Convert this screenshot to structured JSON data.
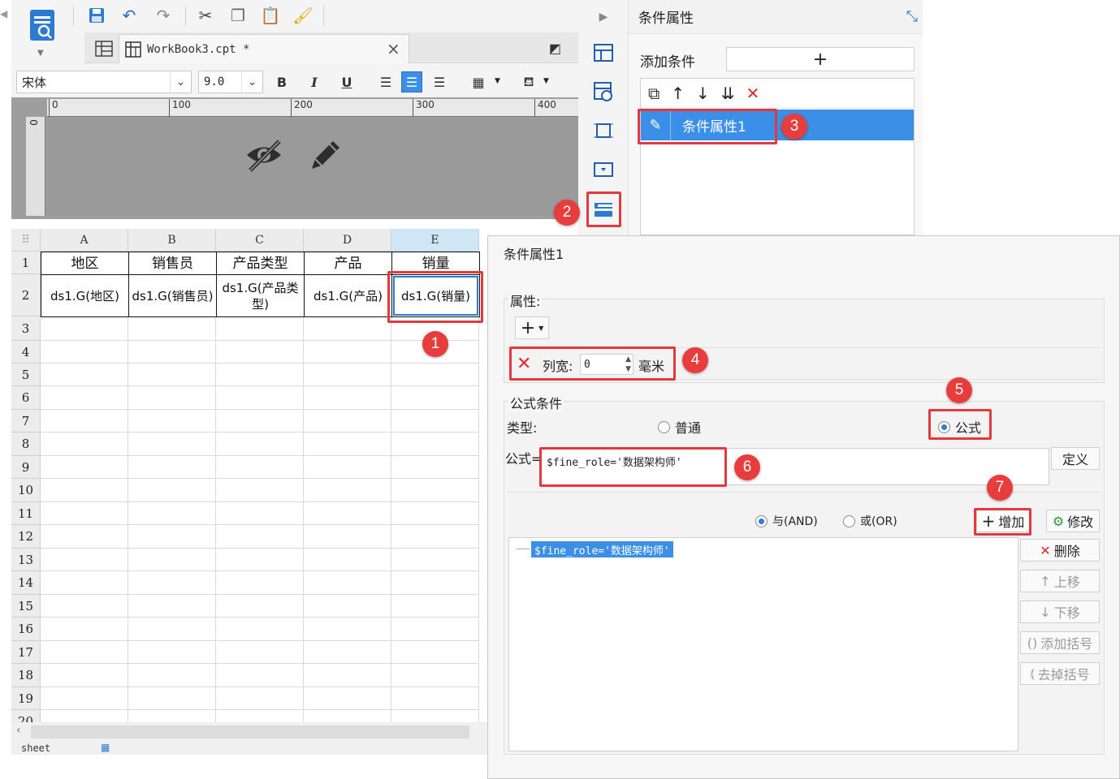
{
  "toolbar": {
    "doc_tab": "WorkBook3.cpt *",
    "font_name": "宋体",
    "font_size": "9.0",
    "bold": "B",
    "italic": "I",
    "underline": "U"
  },
  "ruler": {
    "ticks": [
      "0",
      "100",
      "200",
      "300",
      "400"
    ],
    "left_tick": "0"
  },
  "grid": {
    "columns": [
      "A",
      "B",
      "C",
      "D",
      "E"
    ],
    "rows": [
      "1",
      "2",
      "3",
      "4",
      "5",
      "6",
      "7",
      "8",
      "9",
      "10",
      "11",
      "12",
      "13",
      "14",
      "15",
      "16",
      "17",
      "18",
      "19",
      "20"
    ],
    "header_cells": [
      "地区",
      "销售员",
      "产品类型",
      "产品",
      "销量"
    ],
    "data_cells": [
      "ds1.G(地区)",
      "ds1.G(销售员)",
      "ds1.G(产品类型)",
      "ds1.G(产品)",
      "ds1.G(销量)"
    ]
  },
  "sheet_tab": "sheet",
  "cond_panel": {
    "title": "条件属性",
    "add_label": "添加条件",
    "add_icon": "+",
    "item": "条件属性1"
  },
  "dialog": {
    "title": "条件属性1",
    "attr_label": "属性:",
    "attr_add": "+",
    "col_width_label": "列宽:",
    "col_width_value": "0",
    "col_width_unit": "毫米",
    "formula_cond_label": "公式条件",
    "type_label": "类型:",
    "type_normal": "普通",
    "type_formula": "公式",
    "formula_label": "公式=",
    "formula_value": "$fine_role='数据架构师'",
    "define_button": "定义",
    "and_label": "与(AND)",
    "or_label": "或(OR)",
    "add_button": "增加",
    "modify_button": "修改",
    "delete_button": "删除",
    "up_button": "上移",
    "down_button": "下移",
    "add_bracket_button": "添加括号",
    "remove_bracket_button": "去掉括号",
    "result_item": "$fine_role='数据架构师'"
  },
  "callouts": [
    "1",
    "2",
    "3",
    "4",
    "5",
    "6",
    "7"
  ],
  "colors": {
    "accent": "#3c8fe6",
    "callout": "#e2393f",
    "icon_blue": "#1f5fb0"
  }
}
